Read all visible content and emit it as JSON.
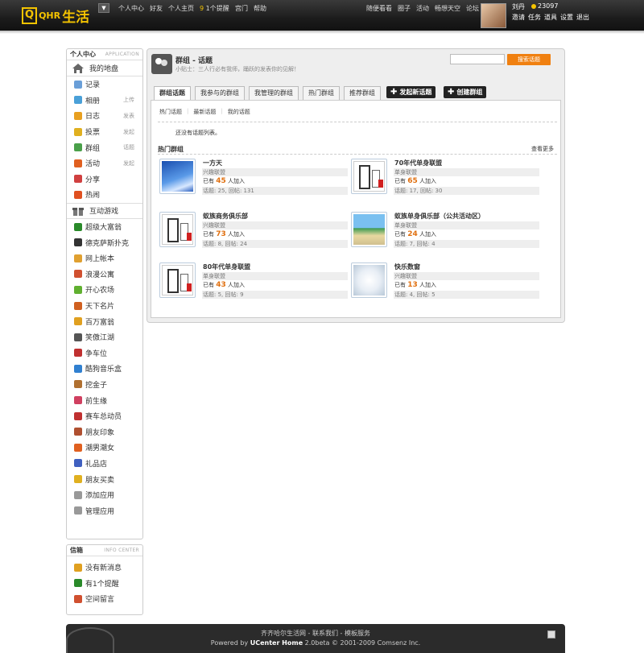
{
  "topbar": {
    "logo_box": "Q",
    "logo_txt": "QHR",
    "logo_cn": "生活",
    "menu_toggle": "▼",
    "nav_left": [
      "个人中心",
      "好友",
      "个人主页"
    ],
    "notice_count": "9",
    "notice_label": "1个提醒",
    "nav_mid": [
      "宫门",
      "帮助"
    ],
    "nav_right": [
      "随便看看",
      "圈子",
      "活动",
      "畅想天空",
      "论坛"
    ],
    "user_name": "刘丹",
    "user_coins": "23097",
    "user_links": [
      "邀请",
      "任务",
      "道具",
      "设置",
      "退出"
    ]
  },
  "sidebar": {
    "head": "个人中心",
    "head_en": "APPLICATION",
    "section1": "我的地盘",
    "items1": [
      {
        "label": "记录",
        "sub": "",
        "color": "#6a9fd8"
      },
      {
        "label": "相册",
        "sub": "上传",
        "color": "#4aa0d8"
      },
      {
        "label": "日志",
        "sub": "发表",
        "color": "#e8a020"
      },
      {
        "label": "投票",
        "sub": "发起",
        "color": "#e0b020"
      },
      {
        "label": "群组",
        "sub": "话题",
        "color": "#4aa04a"
      },
      {
        "label": "活动",
        "sub": "发起",
        "color": "#e06020"
      },
      {
        "label": "分享",
        "sub": "",
        "color": "#d04040"
      },
      {
        "label": "热闹",
        "sub": "",
        "color": "#e05020"
      }
    ],
    "section2": "互动游戏",
    "items2": [
      {
        "label": "超级大富翁",
        "color": "#2a8a2a"
      },
      {
        "label": "德克萨斯扑克",
        "color": "#333333"
      },
      {
        "label": "网上帐本",
        "color": "#e0a030"
      },
      {
        "label": "浪漫公寓",
        "color": "#d05030"
      },
      {
        "label": "开心农场",
        "color": "#60b030"
      },
      {
        "label": "天下名片",
        "color": "#d06020"
      },
      {
        "label": "百万富翁",
        "color": "#e0a020"
      },
      {
        "label": "笑傲江湖",
        "color": "#555555"
      },
      {
        "label": "争车位",
        "color": "#c03030"
      },
      {
        "label": "酷狗音乐盒",
        "color": "#3080d0"
      },
      {
        "label": "挖金子",
        "color": "#b07030"
      },
      {
        "label": "前生缘",
        "color": "#d04060"
      },
      {
        "label": "赛车总动员",
        "color": "#c03030"
      },
      {
        "label": "朋友印象",
        "color": "#b05030"
      },
      {
        "label": "潮男潮女",
        "color": "#e06020"
      },
      {
        "label": "礼品店",
        "color": "#4060c0"
      },
      {
        "label": "朋友买卖",
        "color": "#e0b020"
      },
      {
        "label": "添加应用",
        "color": "#999999"
      },
      {
        "label": "管理应用",
        "color": "#999999"
      }
    ],
    "inbox_head": "信箱",
    "inbox_head_en": "INFO CENTER",
    "inbox_items": [
      {
        "label": "没有新消息",
        "color": "#e0a020"
      },
      {
        "label": "有1个提醒",
        "color": "#2a8a2a"
      },
      {
        "label": "空间留言",
        "color": "#d05030"
      }
    ]
  },
  "main": {
    "title": "群组 - 话题",
    "tip": "小贴士：三人行必有我师，踊跃的发表你的见解！",
    "search_btn": "搜索话题",
    "tabs": [
      "群组话题",
      "我参与的群组",
      "我管理的群组",
      "热门群组",
      "推荐群组"
    ],
    "btn_new_topic": "发起新话题",
    "btn_create_group": "创建群组",
    "subtabs": [
      "热门话题",
      "最新话题",
      "我的话题"
    ],
    "empty": "还没有话题列表。",
    "hot_title": "热门群组",
    "hot_more": "查看更多",
    "joined_prefix": "已有",
    "joined_suffix": "人加入",
    "groups": [
      {
        "name": "一方天",
        "category": "兴趣联盟",
        "members": "45",
        "stats": "话题: 25, 回帖: 131",
        "thumb": "sky"
      },
      {
        "name": "70年代单身联盟",
        "category": "单身联盟",
        "members": "65",
        "stats": "话题: 17, 回帖: 30",
        "thumb": "group"
      },
      {
        "name": "蚁族商务俱乐部",
        "category": "兴趣联盟",
        "members": "73",
        "stats": "话题: 8, 回帖: 24",
        "thumb": "group"
      },
      {
        "name": "蚁族单身俱乐部（公共活动区）",
        "category": "单身联盟",
        "members": "24",
        "stats": "话题: 7, 回帖: 4",
        "thumb": "beach"
      },
      {
        "name": "80年代单身联盟",
        "category": "单身联盟",
        "members": "43",
        "stats": "话题: 5, 回帖: 9",
        "thumb": "group"
      },
      {
        "name": "快乐数窗",
        "category": "兴趣联盟",
        "members": "13",
        "stats": "话题: 4, 回帖: 5",
        "thumb": "dish"
      }
    ]
  },
  "footer": {
    "line1": "齐齐哈尔生活网 - 联系我们 - 模板服务",
    "powered": "Powered by",
    "product": "UCenter Home",
    "version": "2.0beta © 2001-2009 Comsenz Inc."
  }
}
